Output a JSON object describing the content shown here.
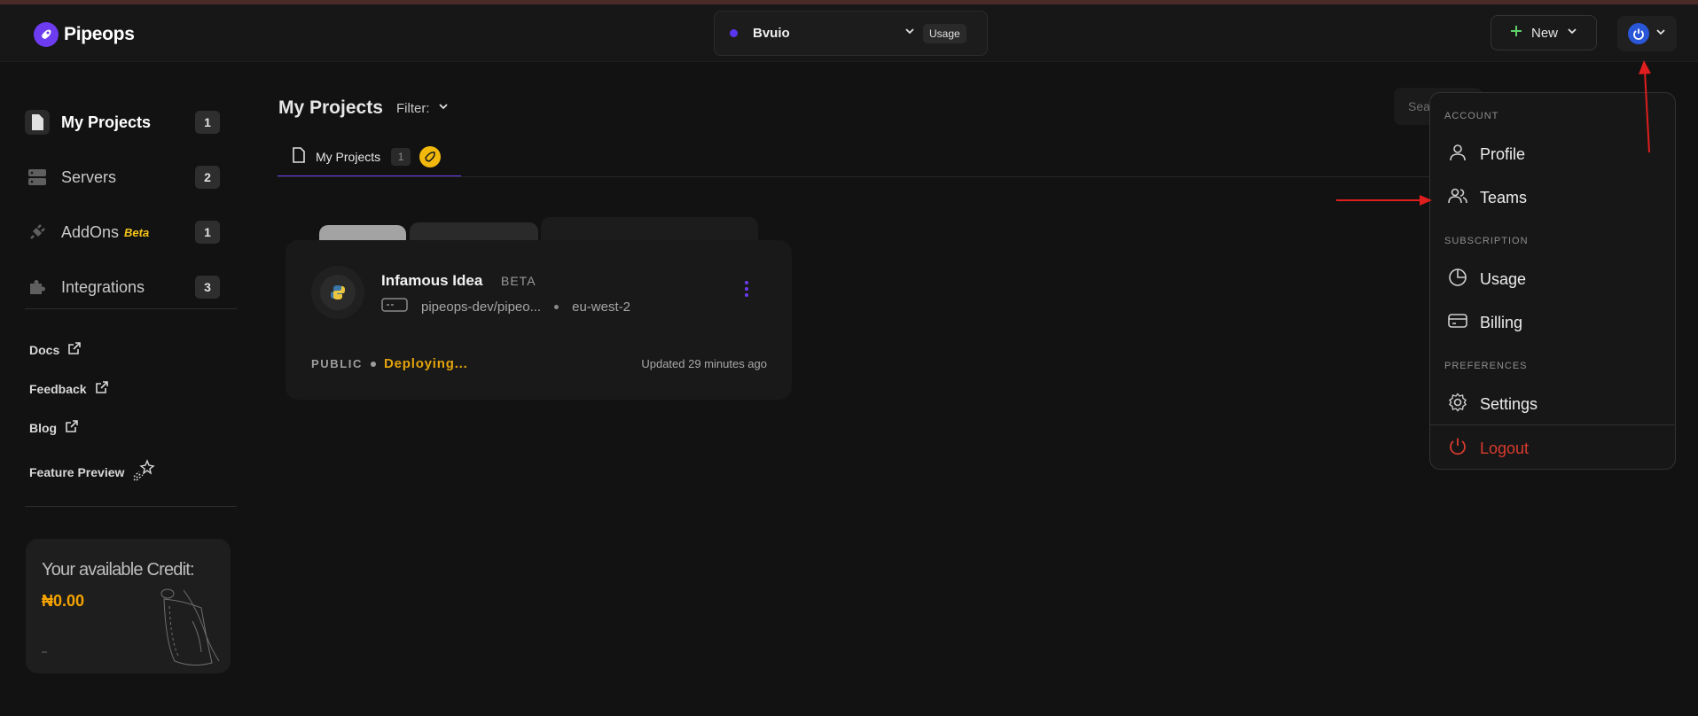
{
  "brand": {
    "name": "Pipeops",
    "accent": "#6d3cf0"
  },
  "workspace": {
    "name": "Bvuio",
    "usage_label": "Usage"
  },
  "header": {
    "new_label": "New"
  },
  "sidebar": {
    "items": [
      {
        "label": "My Projects",
        "count": "1",
        "icon": "file-icon"
      },
      {
        "label": "Servers",
        "count": "2",
        "icon": "server-icon"
      },
      {
        "label": "AddOns",
        "tag": "Beta",
        "count": "1",
        "icon": "plug-icon"
      },
      {
        "label": "Integrations",
        "count": "3",
        "icon": "puzzle-icon"
      }
    ],
    "links": [
      {
        "label": "Docs",
        "icon": "external-link-icon"
      },
      {
        "label": "Feedback",
        "icon": "external-link-icon"
      },
      {
        "label": "Blog",
        "icon": "external-link-icon"
      },
      {
        "label": "Feature Preview",
        "icon": "sparkle-icon"
      }
    ],
    "credit": {
      "title": "Your available Credit:",
      "value": "₦0.00"
    }
  },
  "main": {
    "title": "My Projects",
    "filter_label": "Filter:",
    "search_placeholder": "Sea",
    "tab": {
      "label": "My Projects",
      "count": "1"
    }
  },
  "project": {
    "name": "Infamous Idea",
    "tag": "BETA",
    "repo": "pipeops-dev/pipeo...",
    "region": "eu-west-2",
    "visibility": "PUBLIC",
    "status": "Deploying...",
    "updated": "Updated 29 minutes ago"
  },
  "dropdown": {
    "sections": [
      "ACCOUNT",
      "SUBSCRIPTION",
      "PREFERENCES"
    ],
    "items": [
      "Profile",
      "Teams",
      "Usage",
      "Billing",
      "Settings"
    ],
    "logout": "Logout"
  }
}
